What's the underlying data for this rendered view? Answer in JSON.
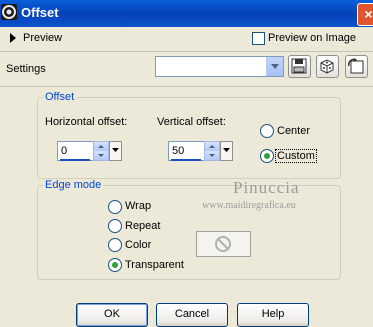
{
  "window": {
    "title": "Offset",
    "close_symbol": "×"
  },
  "preview": {
    "toggle_label": "Preview",
    "preview_on_image_label": "Preview on Image",
    "preview_on_image_checked": false
  },
  "settings": {
    "label": "Settings",
    "preset_value": "",
    "buttons": [
      "save-icon",
      "randomize-dice-icon",
      "reset-icon"
    ]
  },
  "offset": {
    "legend": "Offset",
    "horizontal_label": "Horizontal offset:",
    "horizontal_value": "0",
    "vertical_label": "Vertical offset:",
    "vertical_value": "50",
    "options": [
      {
        "label": "Center",
        "selected": false
      },
      {
        "label": "Custom",
        "selected": true
      }
    ]
  },
  "edge_mode": {
    "legend": "Edge mode",
    "options": [
      {
        "label": "Wrap",
        "selected": false
      },
      {
        "label": "Repeat",
        "selected": false
      },
      {
        "label": "Color",
        "selected": false
      },
      {
        "label": "Transparent",
        "selected": true
      }
    ],
    "color_swatch_icon": "no-color-icon"
  },
  "watermark": {
    "name": "Pinuccia",
    "url": "www.maidiregrafica.eu"
  },
  "footer": {
    "ok_label": "OK",
    "cancel_label": "Cancel",
    "help_label": "Help"
  },
  "colors": {
    "title_bar": "#0A53CC",
    "accent_text": "#0046D5",
    "dialog_bg": "#ECE9D8"
  }
}
